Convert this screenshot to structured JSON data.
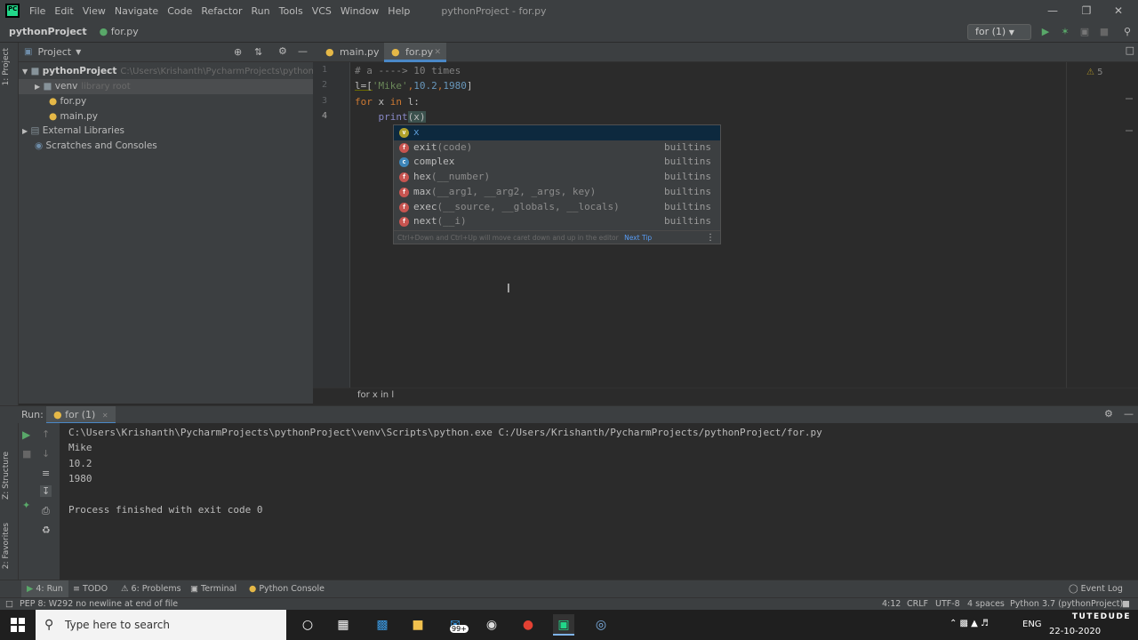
{
  "titlebar": {
    "menu": [
      "File",
      "Edit",
      "View",
      "Navigate",
      "Code",
      "Refactor",
      "Run",
      "Tools",
      "VCS",
      "Window",
      "Help"
    ],
    "window_title": "pythonProject - for.py"
  },
  "navbar": {
    "project": "pythonProject",
    "file": "for.py",
    "run_config": "for (1)"
  },
  "side_tabs": {
    "project": "1: Project",
    "structure": "Z: Structure",
    "favorites": "2: Favorites"
  },
  "project_panel": {
    "title": "Project",
    "tree": [
      {
        "label": "pythonProject",
        "hint": "C:\\Users\\Krishanth\\PycharmProjects\\pythonProject"
      },
      {
        "label": "venv",
        "hint": "library root"
      },
      {
        "label": "for.py",
        "hint": ""
      },
      {
        "label": "main.py",
        "hint": ""
      },
      {
        "label": "External Libraries",
        "hint": ""
      },
      {
        "label": "Scratches and Consoles",
        "hint": ""
      }
    ]
  },
  "editor": {
    "tabs": [
      "main.py",
      "for.py"
    ],
    "line_numbers": [
      "1",
      "2",
      "3",
      "4"
    ],
    "code": {
      "line1": "# a ----> 10 times",
      "line2_a": "l=[",
      "line2_b": "'Mike'",
      "line2_c": ",",
      "line2_d": "10.2",
      "line2_e": ",",
      "line2_f": "1980",
      "line2_g": "]",
      "line3_a": "for",
      "line3_b": " x ",
      "line3_c": "in",
      "line3_d": " l:",
      "line4_a": "print",
      "line4_b": "(x)"
    },
    "inspection_count": "5",
    "breadcrumb": "for x in l"
  },
  "completion": {
    "items": [
      {
        "badge": "v",
        "name": "x",
        "params": "",
        "type": ""
      },
      {
        "badge": "f",
        "name": "exit",
        "params": "(code)",
        "type": "builtins"
      },
      {
        "badge": "c",
        "name": "complex",
        "params": "",
        "type": "builtins"
      },
      {
        "badge": "f",
        "name": "hex",
        "params": "(__number)",
        "type": "builtins"
      },
      {
        "badge": "f",
        "name": "max",
        "params": "(__arg1, __arg2, _args, key)",
        "type": "builtins"
      },
      {
        "badge": "f",
        "name": "exec",
        "params": "(__source, __globals, __locals)",
        "type": "builtins"
      },
      {
        "badge": "f",
        "name": "next",
        "params": "(__i)",
        "type": "builtins"
      }
    ],
    "tip": "Ctrl+Down and Ctrl+Up will move caret down and up in the editor",
    "next_tip": "Next Tip"
  },
  "run_panel": {
    "label": "Run:",
    "tab": "for (1)",
    "output": [
      "C:\\Users\\Krishanth\\PycharmProjects\\pythonProject\\venv\\Scripts\\python.exe C:/Users/Krishanth/PycharmProjects/pythonProject/for.py",
      "Mike",
      "10.2",
      "1980",
      "",
      "Process finished with exit code 0"
    ]
  },
  "bottom_tabs": [
    "4: Run",
    "TODO",
    "6: Problems",
    "Terminal",
    "Python Console"
  ],
  "event_log": "Event Log",
  "status": {
    "message": "PEP 8: W292 no newline at end of file",
    "position": "4:12",
    "line_sep": "CRLF",
    "encoding": "UTF-8",
    "indent": "4 spaces",
    "interpreter": "Python 3.7 (pythonProject)"
  },
  "taskbar": {
    "search": "Type here to search",
    "mail_badge": "99+",
    "lang": "ENG",
    "date": "22-10-2020"
  },
  "watermark": "TUTEDUDE",
  "colors": {
    "keyword": "#cc7832",
    "string": "#6a8759",
    "number": "#6897bb",
    "comment": "#808080",
    "builtin": "#8888c6",
    "accent": "#21d789",
    "run_green": "#59a869"
  }
}
